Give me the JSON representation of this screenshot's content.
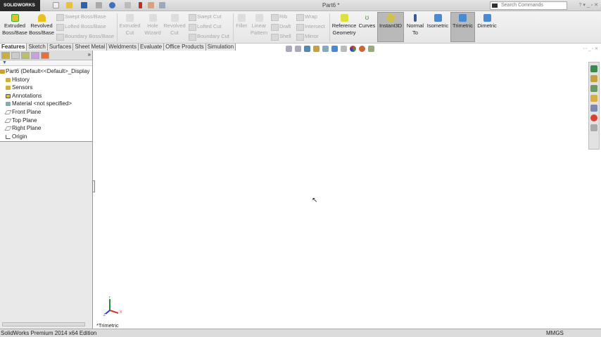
{
  "app": {
    "logo": "SOLIDWORKS",
    "title": "Part6 *",
    "search_placeholder": "Search Commands",
    "window_controls": "? ▾ _ ▫ ✕"
  },
  "ribbon": {
    "extruded_boss": "Extruded Boss/Base",
    "revolved_boss": "Revolved Boss/Base",
    "swept_boss": "Swept Boss/Base",
    "lofted_boss": "Lofted Boss/Base",
    "boundary_boss": "Boundary Boss/Base",
    "extruded_cut": "Extruded Cut",
    "hole_wizard": "Hole Wizard",
    "revolved_cut": "Revolved Cut",
    "swept_cut": "Swept Cut",
    "lofted_cut": "Lofted Cut",
    "boundary_cut": "Boundary Cut",
    "fillet": "Fillet",
    "linear_pattern": "Linear Pattern",
    "rib": "Rib",
    "draft": "Draft",
    "shell": "Shell",
    "wrap": "Wrap",
    "intersect": "Intersect",
    "mirror": "Mirror",
    "reference_geometry": "Reference Geometry",
    "curves": "Curves",
    "instant3d": "Instant3D",
    "normal_to": "Normal To",
    "isometric": "Isometric",
    "trimetric": "Trimetric",
    "dimetric": "Dimetric"
  },
  "tabs": [
    "Features",
    "Sketch",
    "Surfaces",
    "Sheet Metal",
    "Weldments",
    "Evaluate",
    "Office Products",
    "Simulation"
  ],
  "tree": {
    "root": "Part6  (Default<<Default>_Display",
    "items": [
      "History",
      "Sensors",
      "Annotations",
      "Material <not specified>",
      "Front Plane",
      "Top Plane",
      "Right Plane",
      "Origin"
    ]
  },
  "viewport": {
    "view_name": "*Trimetric",
    "axes": {
      "x": "X",
      "y": "Y",
      "z": "Z"
    }
  },
  "status": {
    "edition": "SolidWorks Premium 2014 x64 Edition",
    "units": "MMGS"
  }
}
